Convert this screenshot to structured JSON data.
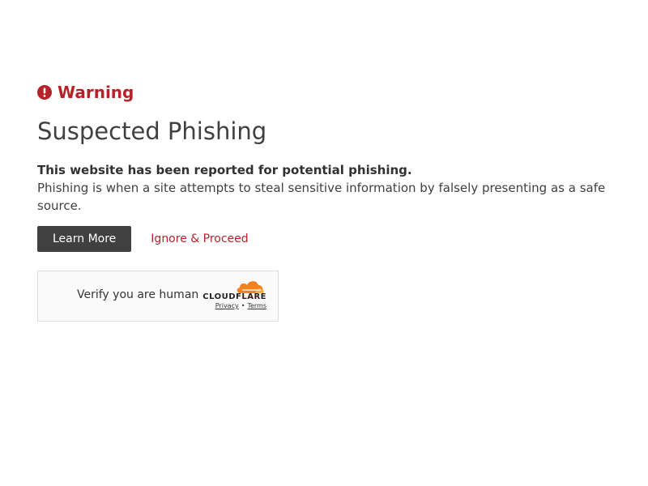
{
  "warning": {
    "title": "Warning",
    "icon": "exclamation-circle-icon",
    "color": "#b4232a"
  },
  "heading": "Suspected Phishing",
  "description": {
    "strong": "This website has been reported for potential phishing.",
    "body": "Phishing is when a site attempts to steal sensitive information by falsely presenting as a safe source."
  },
  "actions": {
    "learn_more": "Learn More",
    "ignore_proceed": "Ignore & Proceed"
  },
  "turnstile": {
    "verify_label": "Verify you are human",
    "brand": "CLOUDFLARE",
    "privacy": "Privacy",
    "separator": "•",
    "terms": "Terms",
    "brand_color": "#f48120"
  }
}
